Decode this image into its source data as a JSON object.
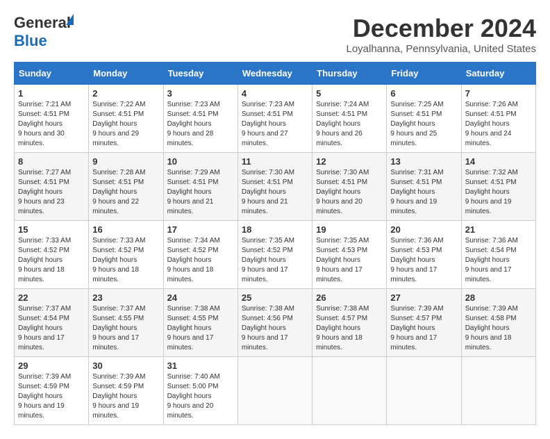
{
  "logo": {
    "line1": "General",
    "line2": "Blue"
  },
  "title": "December 2024",
  "subtitle": "Loyalhanna, Pennsylvania, United States",
  "days_of_week": [
    "Sunday",
    "Monday",
    "Tuesday",
    "Wednesday",
    "Thursday",
    "Friday",
    "Saturday"
  ],
  "weeks": [
    [
      {
        "day": "1",
        "sunrise": "7:21 AM",
        "sunset": "4:51 PM",
        "daylight": "9 hours and 30 minutes."
      },
      {
        "day": "2",
        "sunrise": "7:22 AM",
        "sunset": "4:51 PM",
        "daylight": "9 hours and 29 minutes."
      },
      {
        "day": "3",
        "sunrise": "7:23 AM",
        "sunset": "4:51 PM",
        "daylight": "9 hours and 28 minutes."
      },
      {
        "day": "4",
        "sunrise": "7:23 AM",
        "sunset": "4:51 PM",
        "daylight": "9 hours and 27 minutes."
      },
      {
        "day": "5",
        "sunrise": "7:24 AM",
        "sunset": "4:51 PM",
        "daylight": "9 hours and 26 minutes."
      },
      {
        "day": "6",
        "sunrise": "7:25 AM",
        "sunset": "4:51 PM",
        "daylight": "9 hours and 25 minutes."
      },
      {
        "day": "7",
        "sunrise": "7:26 AM",
        "sunset": "4:51 PM",
        "daylight": "9 hours and 24 minutes."
      }
    ],
    [
      {
        "day": "8",
        "sunrise": "7:27 AM",
        "sunset": "4:51 PM",
        "daylight": "9 hours and 23 minutes."
      },
      {
        "day": "9",
        "sunrise": "7:28 AM",
        "sunset": "4:51 PM",
        "daylight": "9 hours and 22 minutes."
      },
      {
        "day": "10",
        "sunrise": "7:29 AM",
        "sunset": "4:51 PM",
        "daylight": "9 hours and 21 minutes."
      },
      {
        "day": "11",
        "sunrise": "7:30 AM",
        "sunset": "4:51 PM",
        "daylight": "9 hours and 21 minutes."
      },
      {
        "day": "12",
        "sunrise": "7:30 AM",
        "sunset": "4:51 PM",
        "daylight": "9 hours and 20 minutes."
      },
      {
        "day": "13",
        "sunrise": "7:31 AM",
        "sunset": "4:51 PM",
        "daylight": "9 hours and 19 minutes."
      },
      {
        "day": "14",
        "sunrise": "7:32 AM",
        "sunset": "4:51 PM",
        "daylight": "9 hours and 19 minutes."
      }
    ],
    [
      {
        "day": "15",
        "sunrise": "7:33 AM",
        "sunset": "4:52 PM",
        "daylight": "9 hours and 18 minutes."
      },
      {
        "day": "16",
        "sunrise": "7:33 AM",
        "sunset": "4:52 PM",
        "daylight": "9 hours and 18 minutes."
      },
      {
        "day": "17",
        "sunrise": "7:34 AM",
        "sunset": "4:52 PM",
        "daylight": "9 hours and 18 minutes."
      },
      {
        "day": "18",
        "sunrise": "7:35 AM",
        "sunset": "4:52 PM",
        "daylight": "9 hours and 17 minutes."
      },
      {
        "day": "19",
        "sunrise": "7:35 AM",
        "sunset": "4:53 PM",
        "daylight": "9 hours and 17 minutes."
      },
      {
        "day": "20",
        "sunrise": "7:36 AM",
        "sunset": "4:53 PM",
        "daylight": "9 hours and 17 minutes."
      },
      {
        "day": "21",
        "sunrise": "7:36 AM",
        "sunset": "4:54 PM",
        "daylight": "9 hours and 17 minutes."
      }
    ],
    [
      {
        "day": "22",
        "sunrise": "7:37 AM",
        "sunset": "4:54 PM",
        "daylight": "9 hours and 17 minutes."
      },
      {
        "day": "23",
        "sunrise": "7:37 AM",
        "sunset": "4:55 PM",
        "daylight": "9 hours and 17 minutes."
      },
      {
        "day": "24",
        "sunrise": "7:38 AM",
        "sunset": "4:55 PM",
        "daylight": "9 hours and 17 minutes."
      },
      {
        "day": "25",
        "sunrise": "7:38 AM",
        "sunset": "4:56 PM",
        "daylight": "9 hours and 17 minutes."
      },
      {
        "day": "26",
        "sunrise": "7:38 AM",
        "sunset": "4:57 PM",
        "daylight": "9 hours and 18 minutes."
      },
      {
        "day": "27",
        "sunrise": "7:39 AM",
        "sunset": "4:57 PM",
        "daylight": "9 hours and 17 minutes."
      },
      {
        "day": "28",
        "sunrise": "7:39 AM",
        "sunset": "4:58 PM",
        "daylight": "9 hours and 18 minutes."
      }
    ],
    [
      {
        "day": "29",
        "sunrise": "7:39 AM",
        "sunset": "4:59 PM",
        "daylight": "9 hours and 19 minutes."
      },
      {
        "day": "30",
        "sunrise": "7:39 AM",
        "sunset": "4:59 PM",
        "daylight": "9 hours and 19 minutes."
      },
      {
        "day": "31",
        "sunrise": "7:40 AM",
        "sunset": "5:00 PM",
        "daylight": "9 hours and 20 minutes."
      },
      null,
      null,
      null,
      null
    ]
  ]
}
